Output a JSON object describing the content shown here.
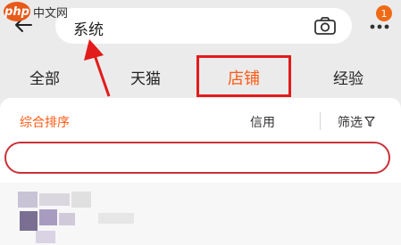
{
  "watermark": {
    "logo_text": "php",
    "site_text": "中文网"
  },
  "header": {
    "back_icon": "arrow-left-icon",
    "search_value": "系统",
    "camera_icon": "camera-icon",
    "more_icon": "more-dots-icon",
    "notification_count": "1"
  },
  "tabs": [
    {
      "label": "全部"
    },
    {
      "label": "天猫"
    },
    {
      "label": "店铺",
      "active": true
    },
    {
      "label": "经验"
    }
  ],
  "filters": {
    "sort_label": "综合排序",
    "credit_label": "信用",
    "filter_label": "筛选",
    "filter_icon": "funnel-icon"
  },
  "colors": {
    "accent": "#ff5a14",
    "highlight_border": "#e21b1b",
    "outline_border": "#c9313a",
    "badge": "#f06a16"
  }
}
